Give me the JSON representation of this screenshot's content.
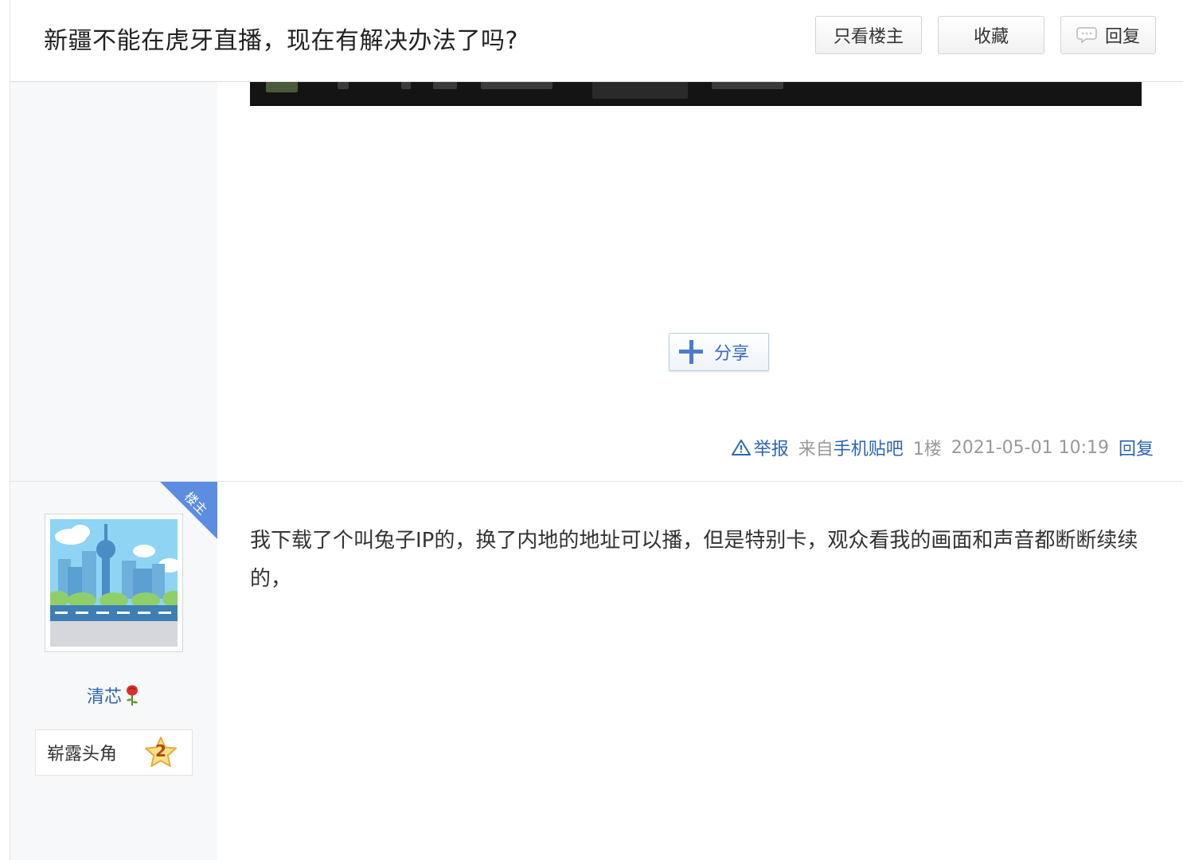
{
  "thread": {
    "title": "新疆不能在虎牙直播，现在有解决办法了吗?",
    "buttons": {
      "only_owner": "只看楼主",
      "favorite": "收藏",
      "reply": "回复"
    }
  },
  "post1": {
    "share_label": "分享",
    "report_label": "举报",
    "client_prefix": "来自",
    "client_link": "手机贴吧",
    "floor": "1楼",
    "time": "2021-05-01 10:19",
    "reply_label": "回复"
  },
  "post2": {
    "owner_badge": "楼主",
    "author_name": "清芯",
    "level_title": "崭露头角",
    "level_number": "2",
    "content": "我下载了个叫兔子IP的，换了内地的地址可以播，但是特别卡，观众看我的画面和声音都断断续续的，"
  },
  "colors": {
    "link": "#2d64b3",
    "badge": "#5b8de0",
    "sidebar_bg": "#f7f8fa"
  }
}
